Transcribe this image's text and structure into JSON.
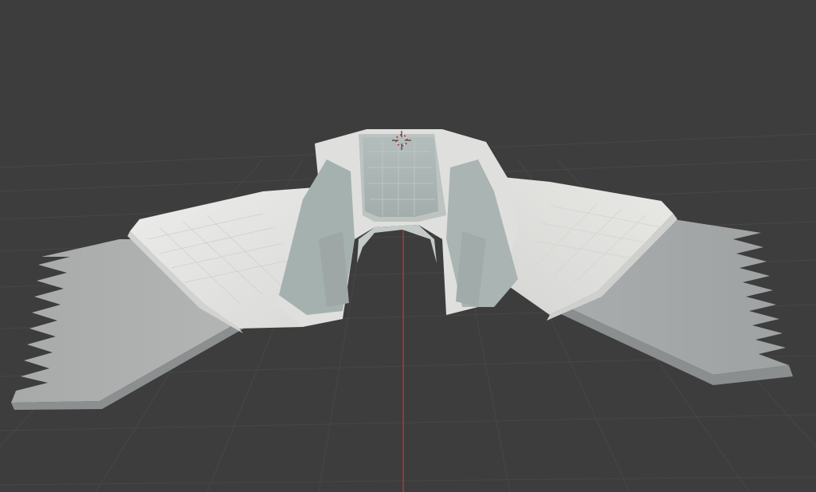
{
  "app": {
    "view": "3d-viewport",
    "shading": "solid"
  },
  "viewport": {
    "background_color": "#3d3d3d",
    "grid_color": "#4a4a4a",
    "y_axis_color": "#b34046",
    "model_light_color": "#e6e6e2",
    "model_mid_color": "#c9cbcb",
    "model_dark_color": "#9a9d9d",
    "model_glass_color": "#a9b4b2",
    "icons": [
      "3d-cursor-icon"
    ]
  }
}
